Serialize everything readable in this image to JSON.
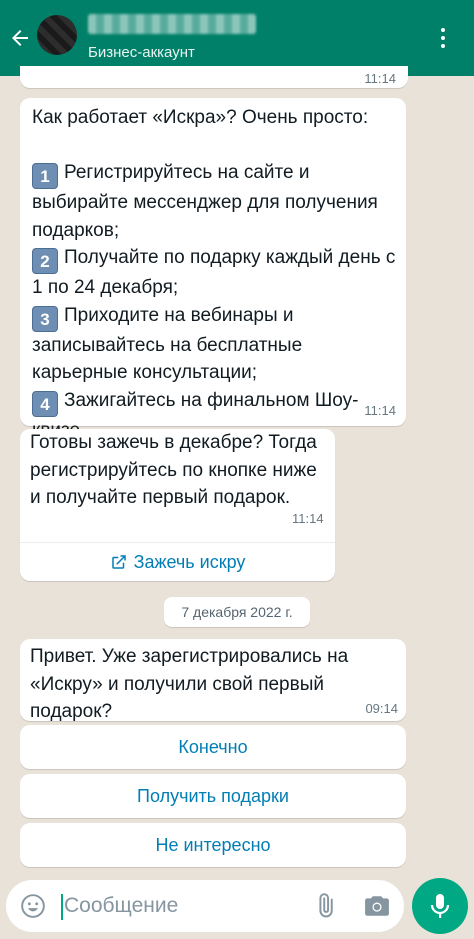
{
  "header": {
    "subtitle": "Бизнес-аккаунт"
  },
  "messages": [
    {
      "time": "11:14"
    },
    {
      "intro": "Как работает «Искра»? Очень просто:",
      "steps": [
        {
          "badge": "1",
          "text": "Регистрируйтесь на сайте и выбирайте мессенджер для получения подарков;"
        },
        {
          "badge": "2",
          "text": "Получайте по подарку каждый день с 1 по 24 декабря;"
        },
        {
          "badge": "3",
          "text": "Приходите на вебинары и записывайтесь на бесплатные карьерные консультации;"
        },
        {
          "badge": "4",
          "text": "Зажигайтесь на финальном Шоу-квизе."
        }
      ],
      "time": "11:14"
    },
    {
      "text": "Готовы зажечь в декабре? Тогда регистрируйтесь по кнопке ниже и получайте первый подарок.",
      "time": "11:14",
      "link_label": "Зажечь искру"
    },
    {
      "text": "Привет. Уже зарегистрировались на «Искру» и получили свой первый подарок?",
      "time": "09:14"
    }
  ],
  "date_separator": "7 декабря 2022 г.",
  "quick_replies": [
    "Конечно",
    "Получить подарки",
    "Не интересно"
  ],
  "composer": {
    "placeholder": "Сообщение",
    "value": ""
  },
  "colors": {
    "header": "#008069",
    "accent": "#00a884",
    "link": "#027eb5",
    "chat_background": "#e9e2d8"
  }
}
